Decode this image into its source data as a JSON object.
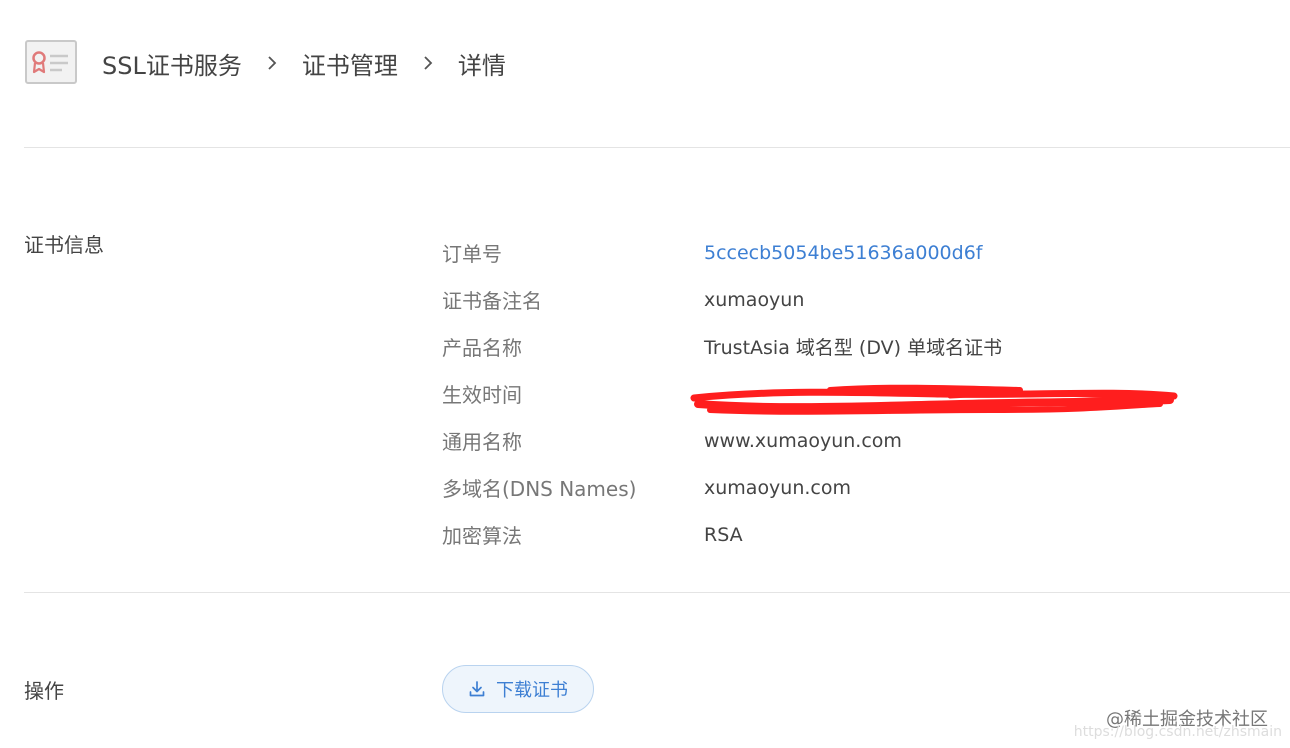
{
  "breadcrumb": {
    "items": [
      "SSL证书服务",
      "证书管理",
      "详情"
    ]
  },
  "icons": {
    "logo": "certificate-icon",
    "separator": "chevron-right-icon",
    "download": "download-icon"
  },
  "cert_info": {
    "title": "证书信息",
    "rows": [
      {
        "label": "订单号",
        "value": "5ccecb5054be51636a000d6f"
      },
      {
        "label": "证书备注名",
        "value": "xumaoyun"
      },
      {
        "label": "产品名称",
        "value": "TrustAsia 域名型 (DV) 单域名证书"
      },
      {
        "label": "生效时间",
        "value": ""
      },
      {
        "label": "通用名称",
        "value": "www.xumaoyun.com"
      },
      {
        "label": "多域名(DNS Names)",
        "value": "xumaoyun.com"
      },
      {
        "label": "加密算法",
        "value": "RSA"
      }
    ]
  },
  "actions": {
    "title": "操作",
    "download_label": "下载证书"
  },
  "watermark": {
    "text": "@稀土掘金技术社区",
    "url": "https://blog.csdn.net/zhsmain"
  },
  "colors": {
    "link": "#3d7fd3",
    "redaction": "#ff1e1e",
    "button_bg": "#eef5fc",
    "divider": "#e4e4e4"
  }
}
